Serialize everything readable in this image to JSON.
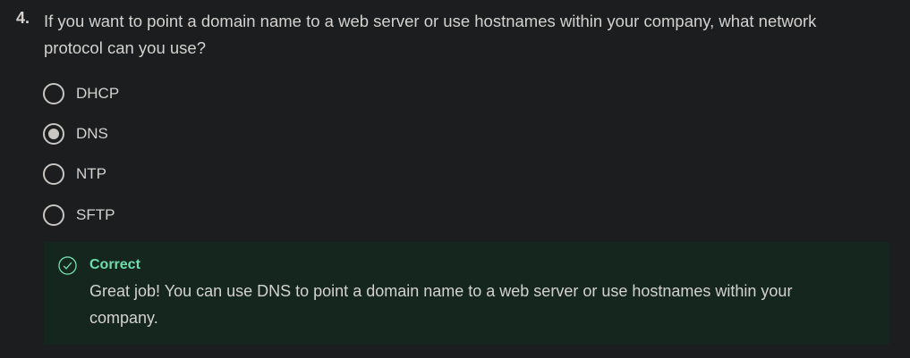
{
  "question": {
    "number": "4.",
    "text": "If you want to point a domain name to a web server or use hostnames within your company, what network protocol can you use?"
  },
  "options": [
    {
      "label": "DHCP",
      "selected": false
    },
    {
      "label": "DNS",
      "selected": true
    },
    {
      "label": "NTP",
      "selected": false
    },
    {
      "label": "SFTP",
      "selected": false
    }
  ],
  "feedback": {
    "title": "Correct",
    "text": "Great job! You can use DNS to point a domain name to a web server or use hostnames within your company.",
    "icon": "check-circle-icon",
    "color": "#6fdcaa"
  }
}
